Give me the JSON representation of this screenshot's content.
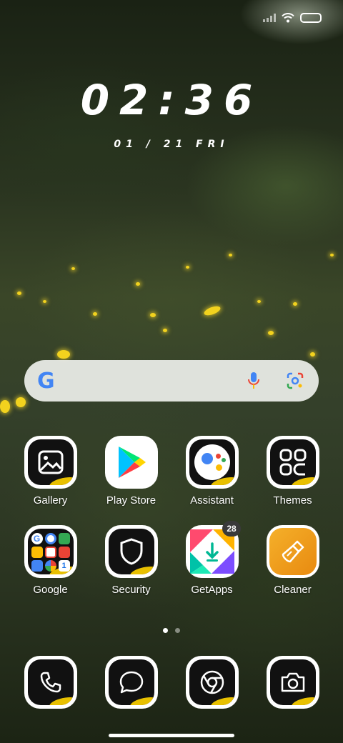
{
  "clock": {
    "time": "02:36",
    "date": "01 / 21 FRI"
  },
  "search": {
    "logo": "G",
    "icons": [
      "mic-icon",
      "lens-icon"
    ]
  },
  "apps": [
    {
      "label": "Gallery",
      "icon": "gallery-icon"
    },
    {
      "label": "Play Store",
      "icon": "play-store-icon"
    },
    {
      "label": "Assistant",
      "icon": "assistant-icon"
    },
    {
      "label": "Themes",
      "icon": "themes-icon"
    },
    {
      "label": "Google",
      "icon": "google-folder-icon"
    },
    {
      "label": "Security",
      "icon": "shield-icon"
    },
    {
      "label": "GetApps",
      "icon": "getapps-icon",
      "badge": "28"
    },
    {
      "label": "Cleaner",
      "icon": "broom-icon"
    }
  ],
  "page_indicator": {
    "current": 1,
    "total": 2
  },
  "dock": [
    {
      "icon": "phone-icon"
    },
    {
      "icon": "messages-icon"
    },
    {
      "icon": "chrome-icon"
    },
    {
      "icon": "camera-icon"
    }
  ],
  "colors": {
    "accent_yellow": "#e8c000",
    "google_blue": "#4285f4",
    "cleaner_orange": "#f0a020"
  }
}
